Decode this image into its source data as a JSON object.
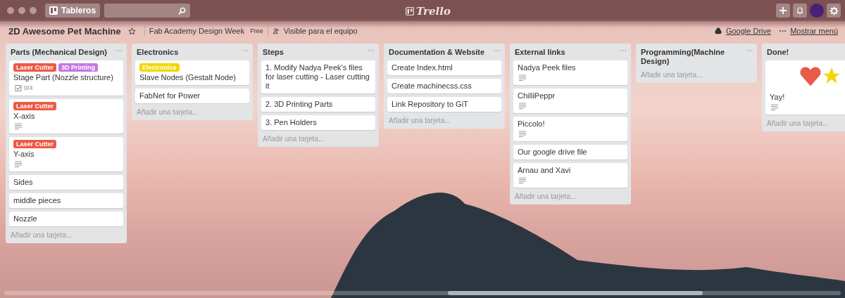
{
  "header": {
    "boards_button": "Tableros",
    "logo": "Trello"
  },
  "board": {
    "title": "2D Awesome Pet Machine",
    "starred": false,
    "team": "Fab Academy Design Week",
    "plan": "Free",
    "visibility": "Visible para el equipo",
    "power_up": "Google Drive",
    "menu": "Mostrar menú"
  },
  "lists": [
    {
      "title": "Parts (Mechanical Design)",
      "add_card": "Añadir una tarjeta...",
      "cards": [
        {
          "labels": [
            {
              "text": "Laser Cutter",
              "color": "#eb5a46"
            },
            {
              "text": "3D Printing",
              "color": "#c377e0"
            }
          ],
          "title": "Stage Part (Nozzle structure)",
          "description": false,
          "checklist": "0/4",
          "stickers": false
        },
        {
          "labels": [
            {
              "text": "Laser Cutter",
              "color": "#eb5a46"
            }
          ],
          "title": "X-axis",
          "description": true,
          "stickers": false
        },
        {
          "labels": [
            {
              "text": "Laser Cutter",
              "color": "#eb5a46"
            }
          ],
          "title": "Y-axis",
          "description": true,
          "stickers": false
        },
        {
          "title": "Sides",
          "description": false,
          "stickers": false
        },
        {
          "title": "middle pieces",
          "description": false,
          "stickers": false
        },
        {
          "title": "Nozzle",
          "description": false,
          "stickers": false
        }
      ]
    },
    {
      "title": "Electronics",
      "add_card": "Añadir una tarjeta...",
      "cards": [
        {
          "labels": [
            {
              "text": "Electronics",
              "color": "#f2d600"
            }
          ],
          "title": "Slave Nodes (Gestalt Node)",
          "description": false,
          "stickers": false
        },
        {
          "title": "FabNet for Power",
          "description": false,
          "stickers": false
        }
      ]
    },
    {
      "title": "Steps",
      "add_card": "Añadir una tarjeta...",
      "cards": [
        {
          "title": "1. Modify Nadya Peek's files for laser cutting - Laser cutting it",
          "description": false,
          "stickers": false
        },
        {
          "title": "2. 3D Printing Parts",
          "description": false,
          "stickers": false
        },
        {
          "title": "3. Pen Holders",
          "description": false,
          "stickers": false
        }
      ]
    },
    {
      "title": "Documentation & Website",
      "add_card": "Añadir una tarjeta...",
      "cards": [
        {
          "title": "Create Index.html",
          "description": false,
          "stickers": false
        },
        {
          "title": "Create machinecss.css",
          "description": false,
          "stickers": false
        },
        {
          "title": "Link Repository to GiT",
          "description": false,
          "stickers": false
        }
      ]
    },
    {
      "title": "External links",
      "add_card": "Añadir una tarjeta...",
      "cards": [
        {
          "title": "Nadya Peek files",
          "description": true,
          "stickers": false
        },
        {
          "title": "ChilliPeppr",
          "description": true,
          "stickers": false
        },
        {
          "title": "Piccolo!",
          "description": true,
          "stickers": false
        },
        {
          "title": "Our google drive file",
          "description": false,
          "stickers": false
        },
        {
          "title": "Arnau and Xavi",
          "description": true,
          "stickers": false
        }
      ]
    },
    {
      "title": "Programming(Machine Design)",
      "add_card": "Añadir una tarjeta..."
    },
    {
      "title": "Done!",
      "add_card": "Añadir una tarjeta...",
      "cards": [
        {
          "title": "Yay!",
          "description": true,
          "stickers": true
        }
      ]
    }
  ]
}
